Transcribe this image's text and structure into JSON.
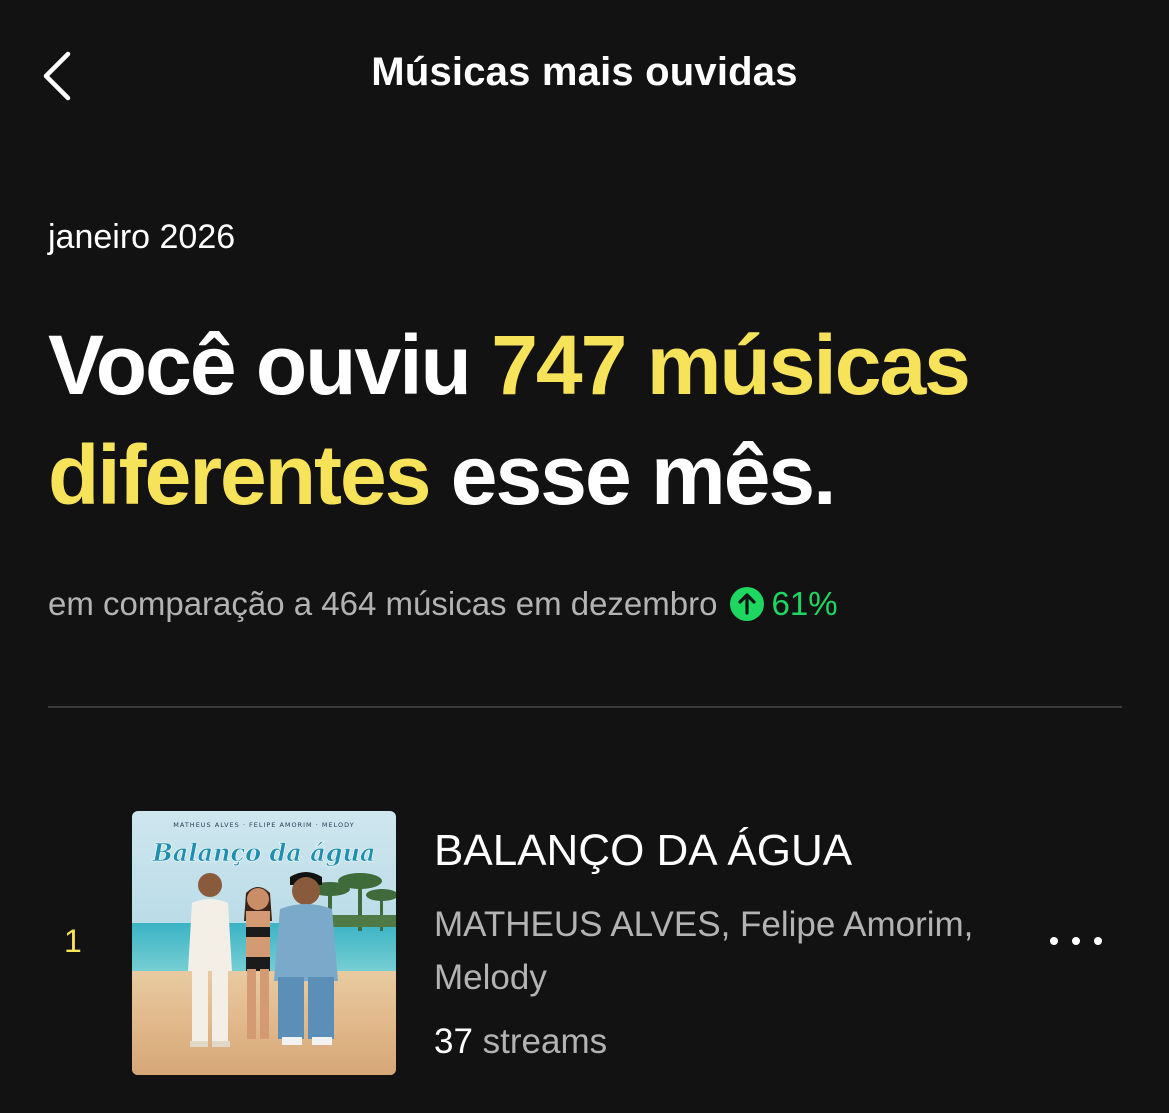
{
  "header": {
    "title": "Músicas mais ouvidas",
    "back_icon": "chevron-left-icon"
  },
  "summary": {
    "period": "janeiro 2026",
    "headline_prefix": "Você ouviu ",
    "headline_highlight_1": "747 músicas",
    "headline_highlight_2": "diferentes",
    "headline_suffix": " esse mês.",
    "unique_tracks": 747,
    "comparison_text": "em comparação a 464 músicas em dezembro",
    "change_icon": "arrow-up-circle-icon",
    "change_percent": "61%"
  },
  "tracks": [
    {
      "rank": "1",
      "title": "BALANÇO DA ÁGUA",
      "artists": "MATHEUS ALVES, Felipe Amorim, Melody",
      "streams_count": "37",
      "streams_label": "streams",
      "cover": {
        "top_credits": "MATHEUS ALVES · FELIPE AMORIM · MELODY",
        "script_title": "Balanço da água"
      },
      "more_icon": "more-horizontal-icon"
    }
  ],
  "colors": {
    "background": "#121212",
    "highlight": "#f7e35a",
    "positive": "#1ed760",
    "secondary_text": "#b3b3b3"
  }
}
